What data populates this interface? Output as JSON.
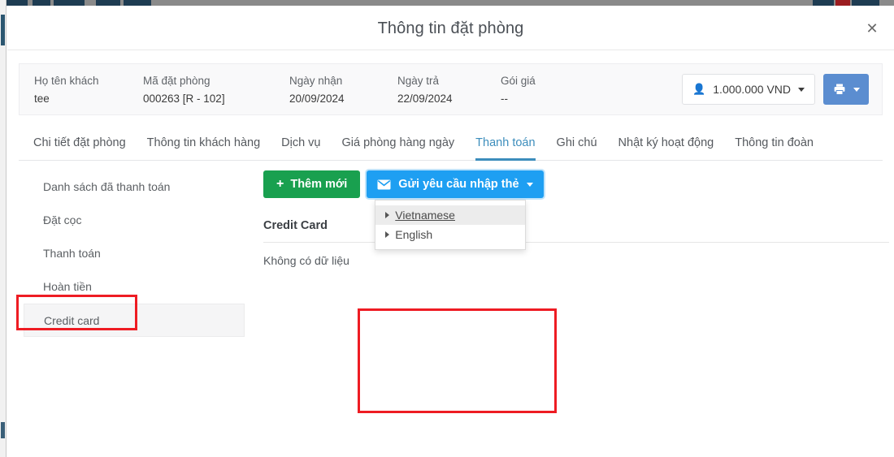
{
  "modal": {
    "title": "Thông tin đặt phòng",
    "close_icon": "close-icon"
  },
  "info_bar": {
    "fields": [
      {
        "label": "Họ tên khách",
        "value": "tee"
      },
      {
        "label": "Mã đặt phòng",
        "value": "000263 [R - 102]"
      },
      {
        "label": "Ngày nhận",
        "value": "20/09/2024"
      },
      {
        "label": "Ngày trả",
        "value": "22/09/2024"
      },
      {
        "label": "Gói giá",
        "value": "--"
      }
    ],
    "price_button": {
      "label": "1.000.000 VND",
      "icon": "person-icon",
      "caret": "chevron-down-icon"
    },
    "print_button": {
      "icon": "printer-icon",
      "caret": "chevron-down-icon"
    }
  },
  "tabs": [
    {
      "label": "Chi tiết đặt phòng",
      "active": false
    },
    {
      "label": "Thông tin khách hàng",
      "active": false
    },
    {
      "label": "Dịch vụ",
      "active": false
    },
    {
      "label": "Giá phòng hàng ngày",
      "active": false
    },
    {
      "label": "Thanh toán",
      "active": true
    },
    {
      "label": "Ghi chú",
      "active": false
    },
    {
      "label": "Nhật ký hoạt động",
      "active": false
    },
    {
      "label": "Thông tin đoàn",
      "active": false
    }
  ],
  "side_menu": [
    {
      "label": "Danh sách đã thanh toán",
      "active": false
    },
    {
      "label": "Đặt cọc",
      "active": false
    },
    {
      "label": "Thanh toán",
      "active": false
    },
    {
      "label": "Hoàn tiền",
      "active": false
    },
    {
      "label": "Credit card",
      "active": true
    }
  ],
  "content": {
    "add_button": {
      "label": "Thêm mới",
      "icon": "plus-icon"
    },
    "send_button": {
      "label": "Gửi yêu cầu nhập thẻ",
      "icon": "envelope-icon",
      "caret": "chevron-down-icon"
    },
    "dropdown": [
      {
        "label": "Vietnamese",
        "hovered": true
      },
      {
        "label": "English",
        "hovered": false
      }
    ],
    "section_title": "Credit Card",
    "empty_text": "Không có dữ liệu"
  },
  "colors": {
    "accent_blue": "#3c8dbc",
    "button_blue": "#1e9ff2",
    "button_green": "#19a04f",
    "print_blue": "#5b8dd0",
    "annotation_red": "#ee1c23"
  }
}
